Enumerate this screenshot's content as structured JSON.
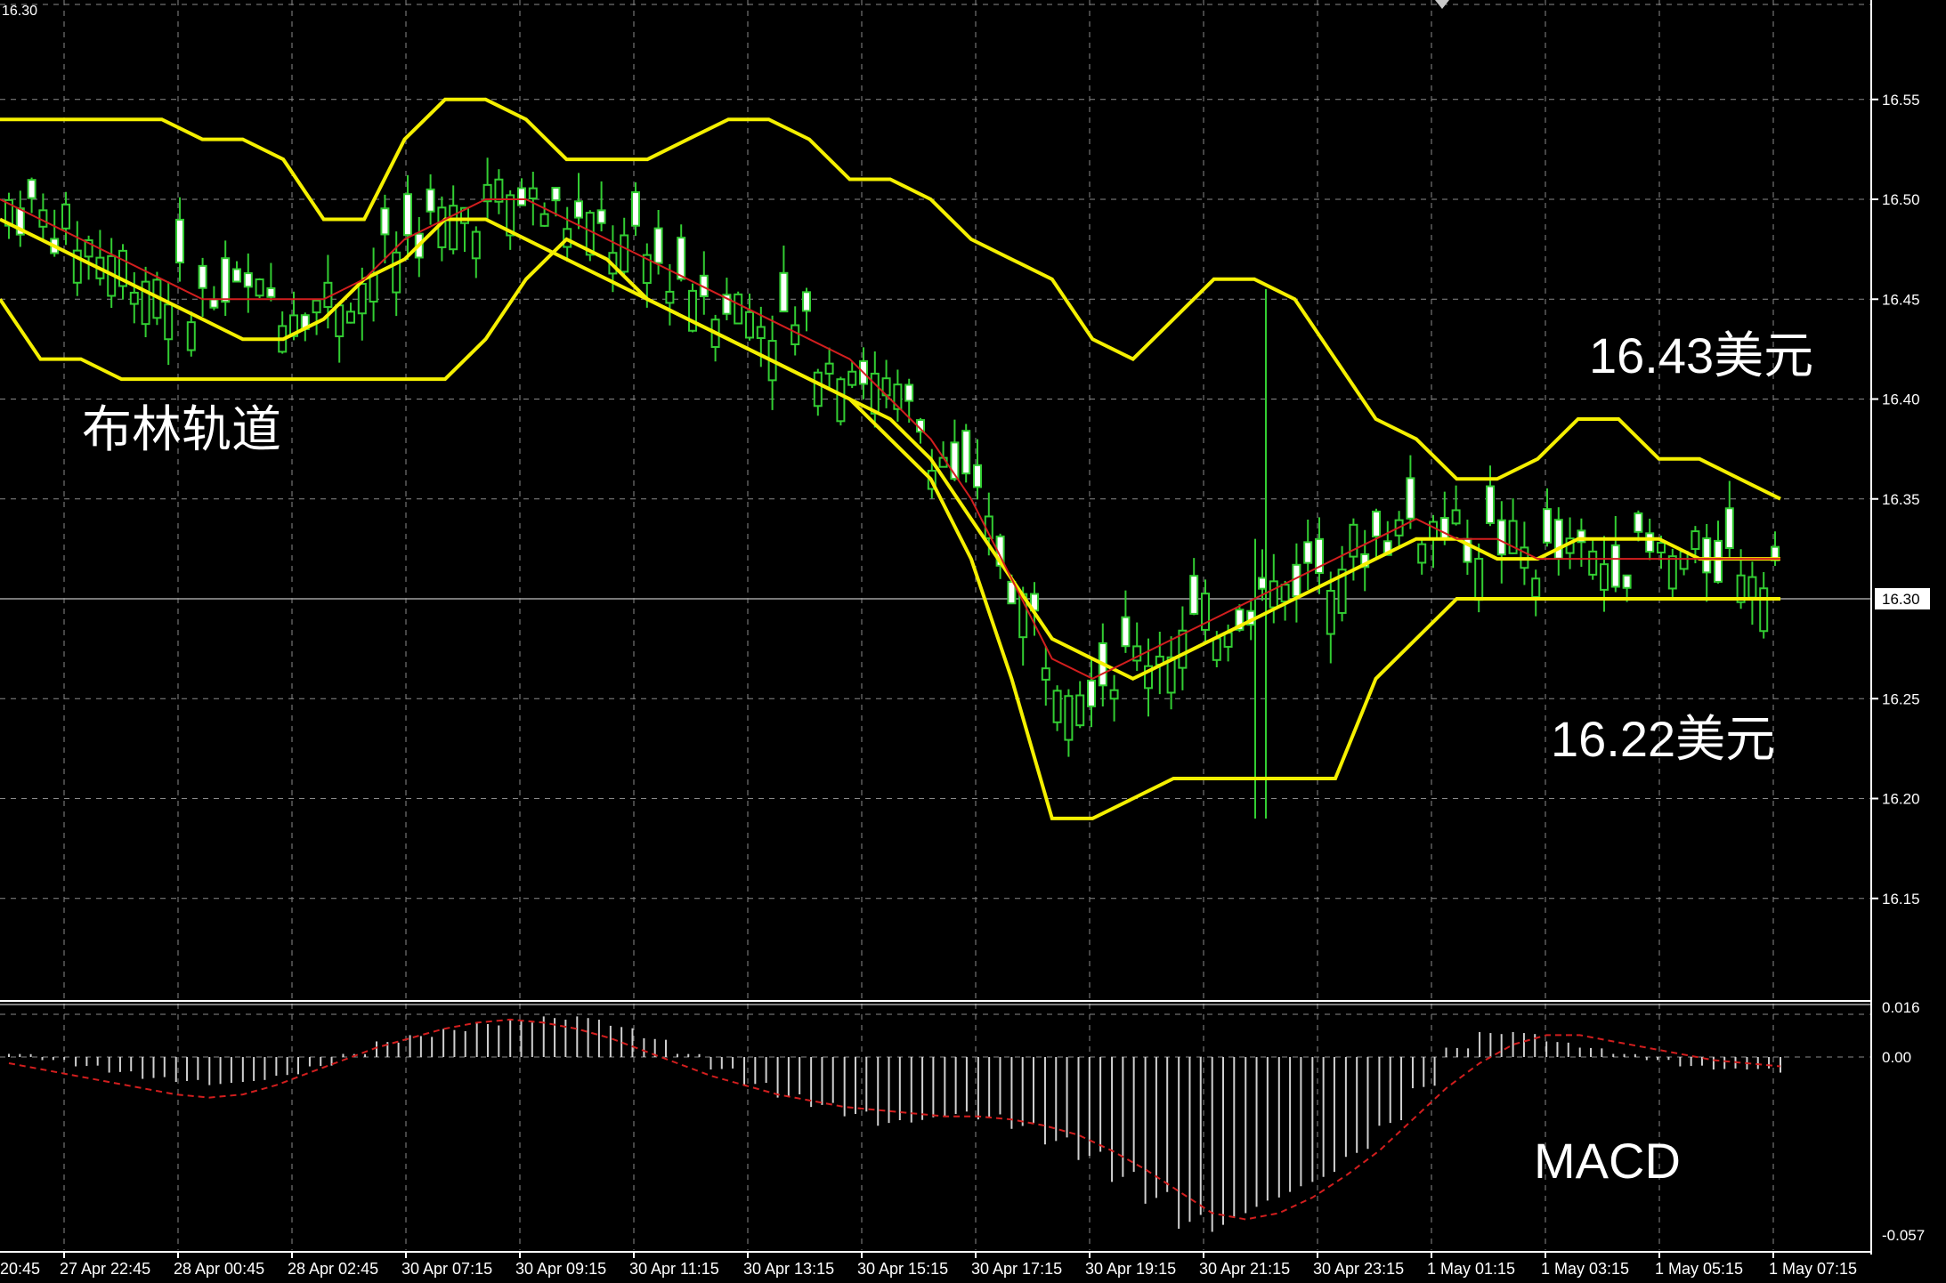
{
  "corner_label": "16.30",
  "annotations": {
    "bollinger": "布林轨道",
    "upper_price": "16.43美元",
    "lower_price": "16.22美元",
    "macd": "MACD"
  },
  "colors": {
    "background": "#000000",
    "grid": "#8a8a8a",
    "bands": "#f5f000",
    "middle_ma": "#d21e1e",
    "candles": "#32cd32",
    "bull_body": "#ffffff",
    "price_line": "#a0a0a0"
  },
  "chart_data": {
    "type": "candlestick",
    "price_axis": {
      "ticks": [
        "16.55",
        "16.50",
        "16.45",
        "16.40",
        "16.35",
        "16.25",
        "16.20",
        "16.15"
      ],
      "current_price": "16.30",
      "ylim": [
        16.1,
        16.6
      ]
    },
    "macd_axis": {
      "ticks": [
        "0.016",
        "0.00",
        "-0.057"
      ],
      "ylim": [
        -0.057,
        0.016
      ]
    },
    "x_labels": [
      "20:45",
      "27 Apr 22:45",
      "28 Apr 00:45",
      "28 Apr 02:45",
      "30 Apr 07:15",
      "30 Apr 09:15",
      "30 Apr 11:15",
      "30 Apr 13:15",
      "30 Apr 15:15",
      "30 Apr 17:15",
      "30 Apr 19:15",
      "30 Apr 21:15",
      "30 Apr 23:15",
      "1 May 01:15",
      "1 May 03:15",
      "1 May 05:15",
      "1 May 07:15"
    ],
    "series": [
      {
        "values": [
          16.54,
          16.54,
          16.54,
          16.54,
          16.54,
          16.53,
          16.53,
          16.52,
          16.49,
          16.49,
          16.53,
          16.55,
          16.55,
          16.54,
          16.52,
          16.52,
          16.52,
          16.53,
          16.54,
          16.54,
          16.53,
          16.51,
          16.51,
          16.5,
          16.48,
          16.47,
          16.46,
          16.43,
          16.42,
          16.44,
          16.46,
          16.46,
          16.45,
          16.42,
          16.39,
          16.38,
          16.36,
          16.36,
          16.37,
          16.39,
          16.39,
          16.37,
          16.37,
          16.36,
          16.35
        ]
      },
      {
        "values": [
          16.49,
          16.48,
          16.47,
          16.46,
          16.45,
          16.44,
          16.43,
          16.43,
          16.44,
          16.46,
          16.47,
          16.49,
          16.49,
          16.48,
          16.47,
          16.46,
          16.45,
          16.44,
          16.43,
          16.42,
          16.41,
          16.4,
          16.39,
          16.37,
          16.34,
          16.31,
          16.28,
          16.27,
          16.26,
          16.27,
          16.28,
          16.29,
          16.3,
          16.31,
          16.32,
          16.33,
          16.33,
          16.32,
          16.32,
          16.33,
          16.33,
          16.33,
          16.32,
          16.32,
          16.32
        ]
      },
      {
        "values": [
          16.45,
          16.42,
          16.42,
          16.41,
          16.41,
          16.41,
          16.41,
          16.41,
          16.41,
          16.41,
          16.41,
          16.41,
          16.43,
          16.46,
          16.48,
          16.47,
          16.45,
          16.44,
          16.43,
          16.42,
          16.41,
          16.4,
          16.38,
          16.36,
          16.32,
          16.26,
          16.19,
          16.19,
          16.2,
          16.21,
          16.21,
          16.21,
          16.21,
          16.21,
          16.26,
          16.28,
          16.3,
          16.3,
          16.3,
          16.3,
          16.3,
          16.3,
          16.3,
          16.3,
          16.3
        ]
      },
      {
        "values": [
          16.5,
          16.49,
          16.48,
          16.47,
          16.46,
          16.45,
          16.45,
          16.45,
          16.45,
          16.46,
          16.48,
          16.49,
          16.5,
          16.5,
          16.49,
          16.48,
          16.47,
          16.46,
          16.45,
          16.44,
          16.43,
          16.42,
          16.4,
          16.38,
          16.35,
          16.31,
          16.27,
          16.26,
          16.27,
          16.28,
          16.29,
          16.3,
          16.31,
          16.32,
          16.33,
          16.34,
          16.33,
          16.33,
          16.32,
          16.32,
          16.32,
          16.32,
          16.32,
          16.32,
          16.32
        ]
      }
    ],
    "macd_histogram": [
      0.001,
      -0.001,
      -0.003,
      -0.005,
      -0.007,
      -0.008,
      -0.009,
      -0.008,
      -0.006,
      -0.003,
      0.001,
      0.005,
      0.007,
      0.009,
      0.011,
      0.012,
      0.013,
      0.013,
      0.01,
      0.006,
      0.001,
      -0.004,
      -0.009,
      -0.013,
      -0.016,
      -0.019,
      -0.022,
      -0.021,
      -0.019,
      -0.02,
      -0.023,
      -0.028,
      -0.033,
      -0.04,
      -0.047,
      -0.055,
      -0.056,
      -0.05,
      -0.045,
      -0.04,
      -0.032,
      -0.022,
      -0.01,
      0.003,
      0.008,
      0.008,
      0.005,
      0.003,
      0.001,
      -0.001,
      -0.003,
      -0.004,
      -0.004,
      -0.005
    ],
    "macd_signal": [
      -0.002,
      -0.004,
      -0.006,
      -0.008,
      -0.01,
      -0.012,
      -0.013,
      -0.012,
      -0.009,
      -0.005,
      -0.001,
      0.003,
      0.006,
      0.009,
      0.011,
      0.012,
      0.011,
      0.009,
      0.006,
      0.002,
      -0.002,
      -0.006,
      -0.009,
      -0.012,
      -0.014,
      -0.016,
      -0.017,
      -0.018,
      -0.019,
      -0.019,
      -0.02,
      -0.022,
      -0.025,
      -0.03,
      -0.036,
      -0.043,
      -0.05,
      -0.052,
      -0.05,
      -0.045,
      -0.038,
      -0.03,
      -0.02,
      -0.01,
      -0.002,
      0.004,
      0.007,
      0.007,
      0.005,
      0.003,
      0.001,
      -0.001,
      -0.002,
      -0.003
    ]
  }
}
